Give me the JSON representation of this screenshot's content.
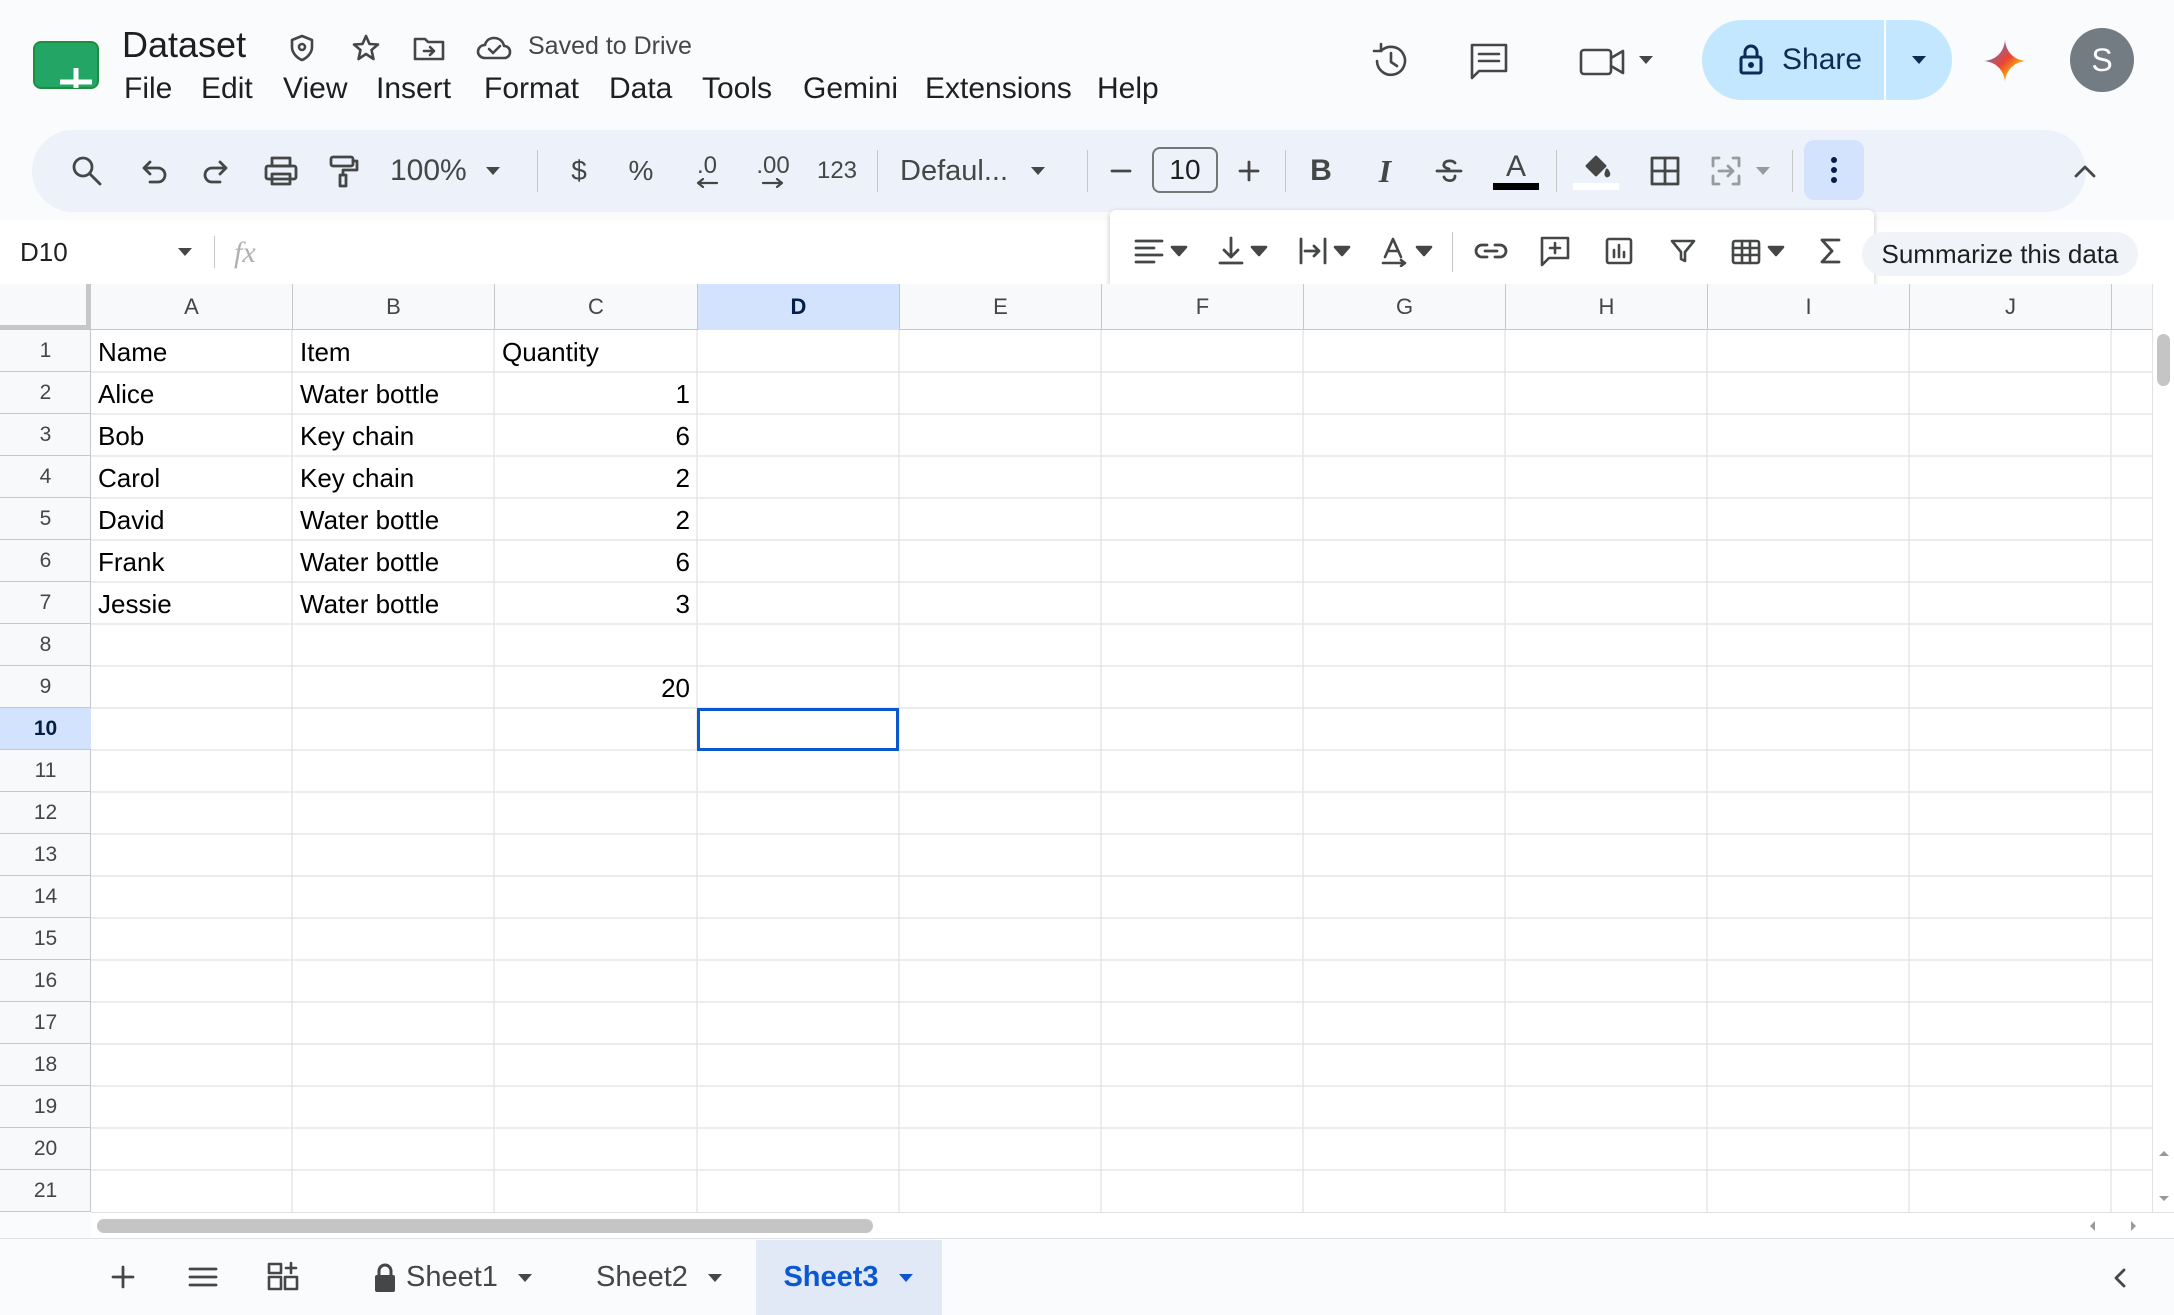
{
  "doc": {
    "title": "Dataset",
    "save_status": "Saved to Drive"
  },
  "menu": [
    "File",
    "Edit",
    "View",
    "Insert",
    "Format",
    "Data",
    "Tools",
    "Gemini",
    "Extensions",
    "Help"
  ],
  "header": {
    "share_label": "Share",
    "avatar_letter": "S"
  },
  "toolbar": {
    "zoom": "100%",
    "currency": "$",
    "percent": "%",
    "dec_decrease": ".0",
    "dec_increase": ".00",
    "number_format": "123",
    "font": "Defaul...",
    "font_size": "10",
    "bold": "B",
    "italic": "I",
    "text_color": "A"
  },
  "formula_bar": {
    "name_box": "D10",
    "fx": "fx",
    "value": ""
  },
  "overflow": {
    "summarize_label": "Summarize this data"
  },
  "columns": [
    "A",
    "B",
    "C",
    "D",
    "E",
    "F",
    "G",
    "H",
    "I",
    "J"
  ],
  "rows": [
    "1",
    "2",
    "3",
    "4",
    "5",
    "6",
    "7",
    "8",
    "9",
    "10",
    "11",
    "12",
    "13",
    "14",
    "15",
    "16",
    "17",
    "18",
    "19",
    "20",
    "21"
  ],
  "cells": {
    "A1": "Name",
    "B1": "Item",
    "C1": "Quantity",
    "A2": "Alice",
    "B2": "Water bottle",
    "C2": "1",
    "A3": "Bob",
    "B3": "Key chain",
    "C3": "6",
    "A4": "Carol",
    "B4": "Key chain",
    "C4": "2",
    "A5": "David",
    "B5": "Water bottle",
    "C5": "2",
    "A6": "Frank",
    "B6": "Water bottle",
    "C6": "6",
    "A7": "Jessie",
    "B7": "Water bottle",
    "C7": "3",
    "C9": "20"
  },
  "selection": {
    "cell": "D10",
    "column": "D",
    "row": "10"
  },
  "sheets": [
    {
      "label": "Sheet1",
      "locked": true,
      "active": false
    },
    {
      "label": "Sheet2",
      "locked": false,
      "active": false
    },
    {
      "label": "Sheet3",
      "locked": false,
      "active": true
    }
  ],
  "colors": {
    "accent": "#0b57d0",
    "share_bg": "#c2e7ff",
    "selected_header": "#d3e3fd",
    "sheets_green": "#0f9d58",
    "avatar_bg": "#737b83"
  }
}
